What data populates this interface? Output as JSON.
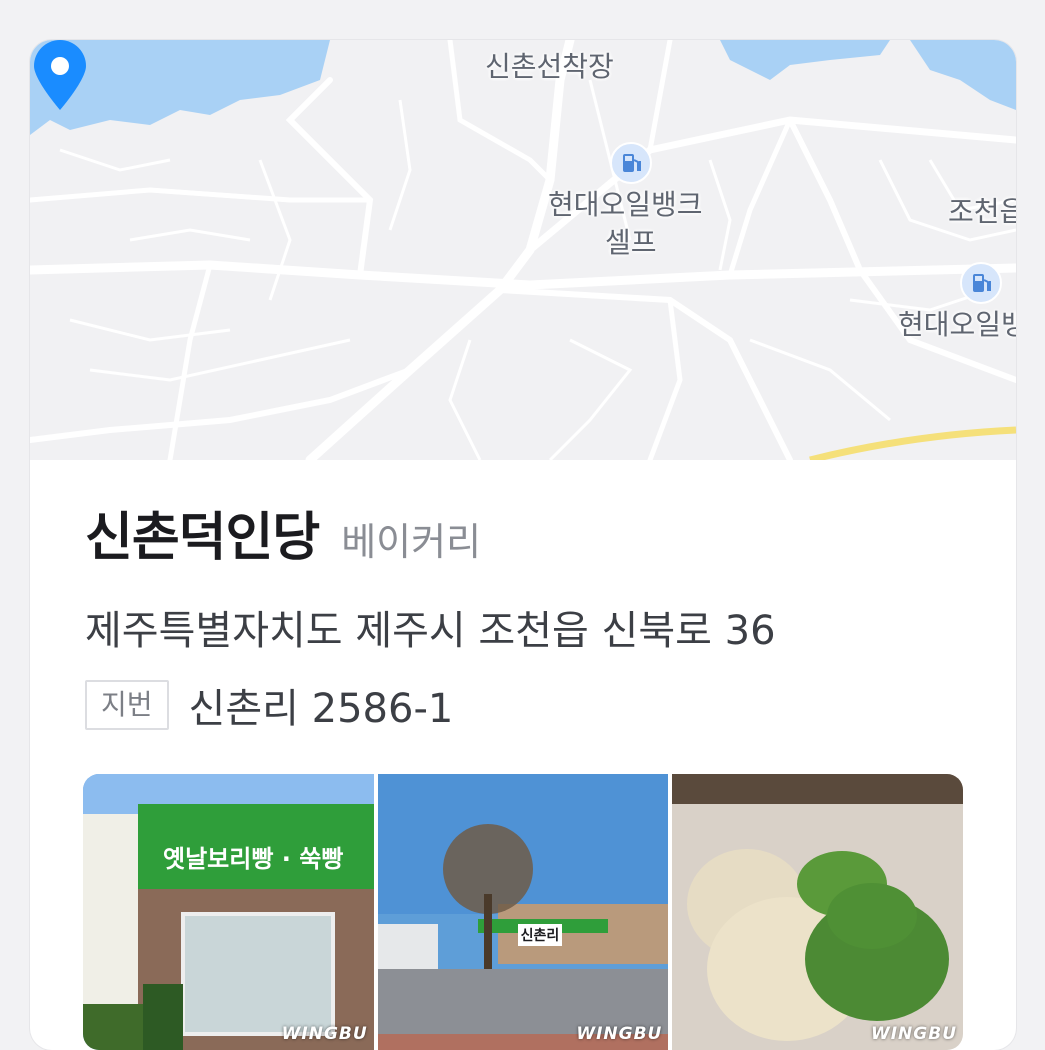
{
  "map": {
    "labels": {
      "wharf": "신촌선착장",
      "gas1_line1": "현대오일뱅크",
      "gas1_line2": "셀프",
      "town": "조천읍",
      "gas2": "현대오일뱅크"
    },
    "icons": {
      "pin": "location-pin-icon",
      "gas": "gas-station-icon"
    },
    "colors": {
      "water": "#a9d1f5",
      "road": "#ffffff",
      "pin": "#1a8cff",
      "highway": "#f5e07a"
    }
  },
  "place": {
    "name": "신촌덕인당",
    "category": "베이커리",
    "address": "제주특별자치도 제주시 조천읍 신북로 36",
    "jibun_label": "지번",
    "jibun": "신촌리 2586-1"
  },
  "photos": [
    {
      "alt": "storefront",
      "watermark": "WINGBU",
      "sign": "옛날보리빵 · 쑥빵"
    },
    {
      "alt": "street view",
      "watermark": "WINGBU",
      "sign": "신촌리"
    },
    {
      "alt": "barley and mugwort buns",
      "watermark": "WINGBU"
    }
  ]
}
